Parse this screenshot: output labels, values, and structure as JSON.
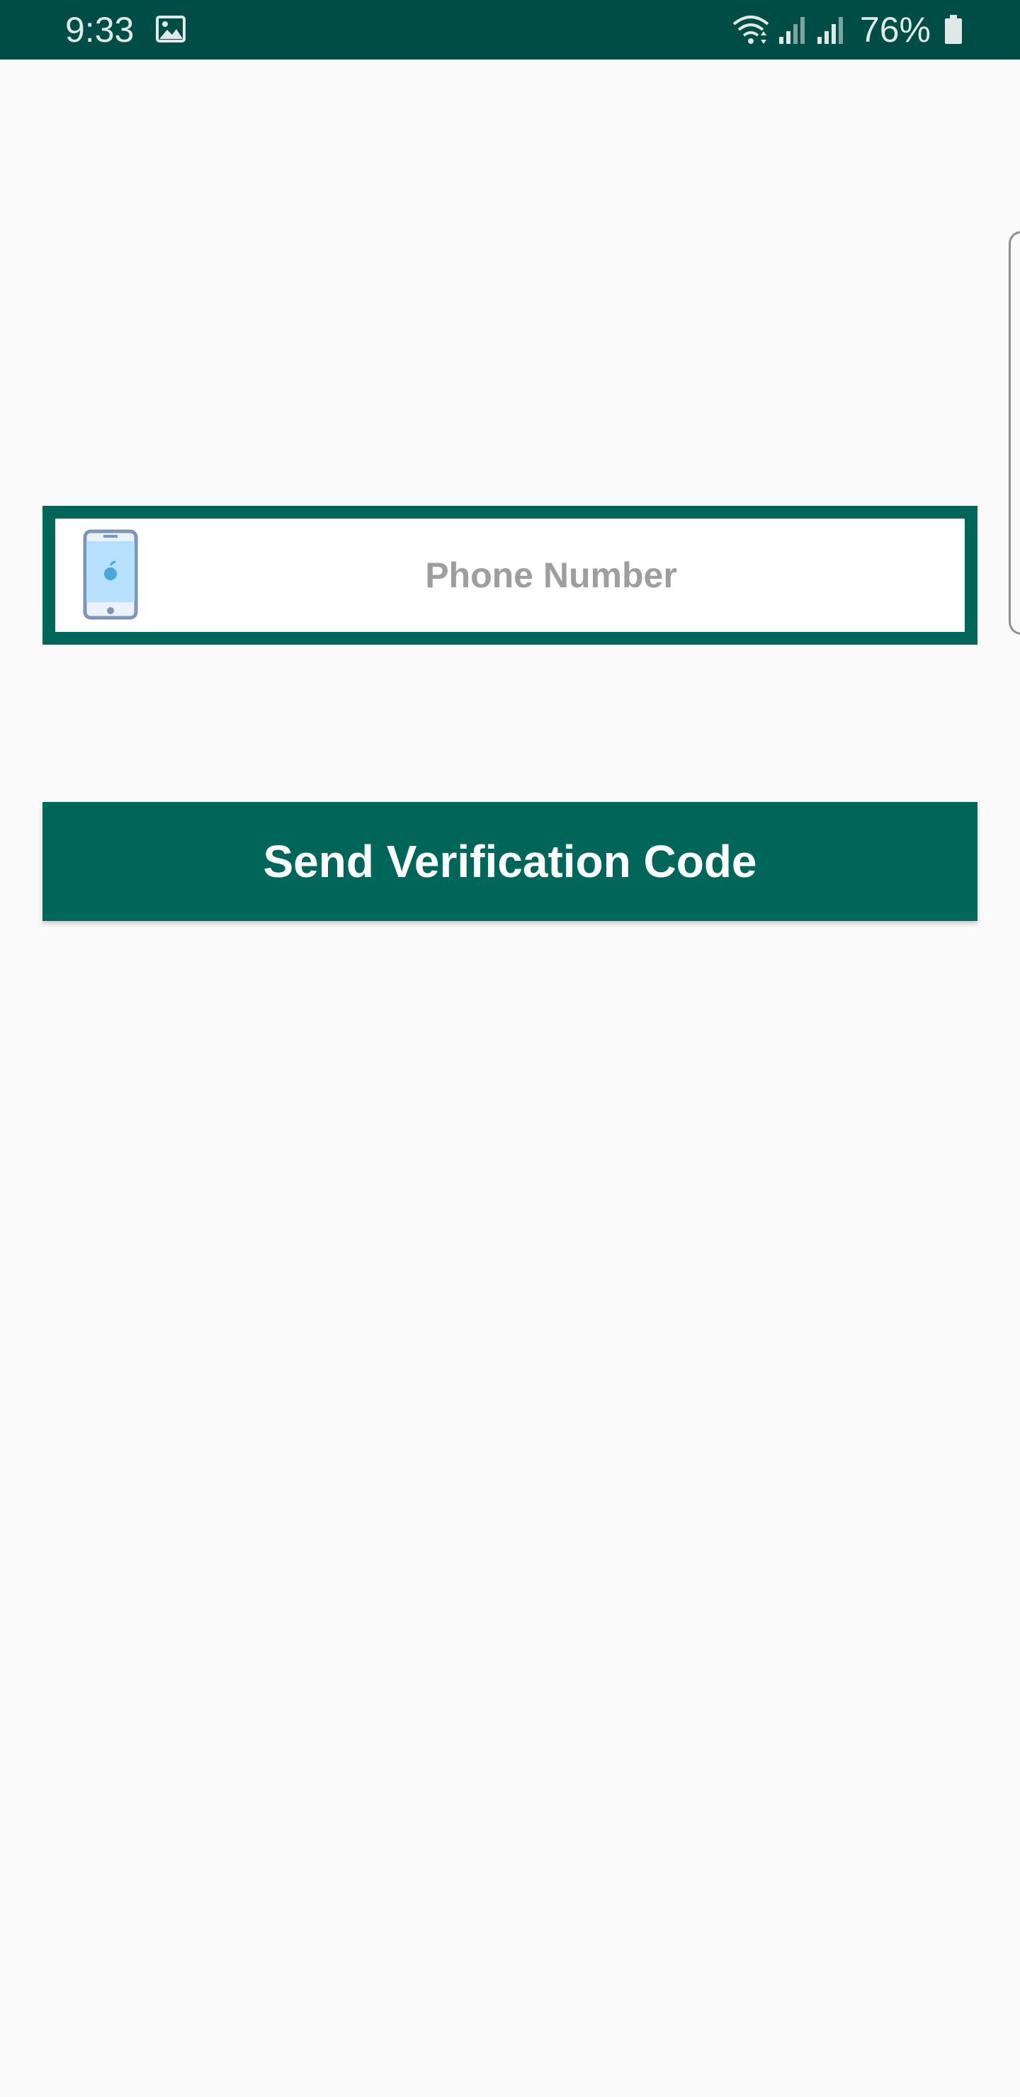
{
  "status_bar": {
    "time": "9:33",
    "battery_percent": "76%",
    "icons": [
      "gallery-icon",
      "wifi-icon",
      "signal-icon",
      "signal-icon",
      "battery-icon"
    ]
  },
  "form": {
    "phone_field": {
      "placeholder": "Phone Number",
      "value": "",
      "icon": "smartphone-icon"
    },
    "send_button_label": "Send Verification Code"
  },
  "colors": {
    "status_bar": "#004d45",
    "accent": "#00665a",
    "background": "#fafafa"
  }
}
